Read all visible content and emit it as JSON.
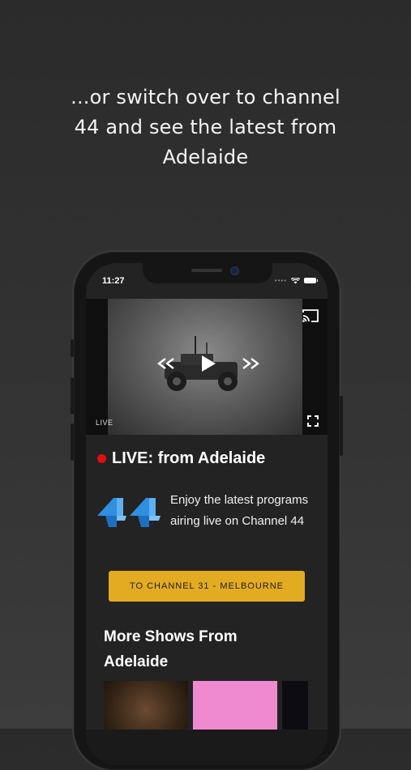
{
  "caption": {
    "line1": "...or switch over to channel",
    "line2": "44 and see the latest from",
    "line3": "Adelaide"
  },
  "status_bar": {
    "time": "11:27"
  },
  "player": {
    "live_label": "LIVE",
    "icons": [
      "cast-icon",
      "rewind-icon",
      "play-icon",
      "fast-forward-icon",
      "fullscreen-icon"
    ]
  },
  "live_title": "LIVE: from Adelaide",
  "channel": {
    "logo_name": "channel-44-logo",
    "description": "Enjoy the latest programs airing live on Channel 44"
  },
  "switch_button_label": "TO CHANNEL 31 - MELBOURNE",
  "more_shows": {
    "title": "More Shows From Adelaide"
  },
  "colors": {
    "accent": "#e3ab22",
    "live_dot": "#e11010",
    "logo_blue": "#2f8fe0",
    "background": "#2e2e2e"
  }
}
